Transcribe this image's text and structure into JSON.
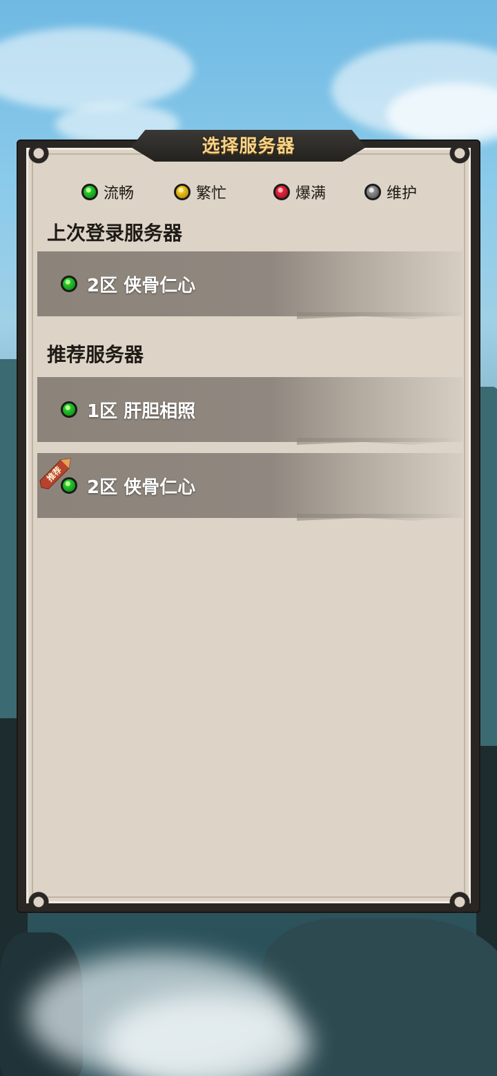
{
  "header": {
    "title": "选择服务器"
  },
  "legend": [
    {
      "label": "流畅",
      "color": "#26c92b",
      "icon": "status-green-dot"
    },
    {
      "label": "繁忙",
      "color": "#f0c21f",
      "icon": "status-yellow-dot"
    },
    {
      "label": "爆满",
      "color": "#e5263d",
      "icon": "status-red-dot"
    },
    {
      "label": "维护",
      "color": "#8f8f8f",
      "icon": "status-gray-dot"
    }
  ],
  "last_login": {
    "title": "上次登录服务器",
    "servers": [
      {
        "name": "2区 侠骨仁心",
        "status": "流畅"
      }
    ]
  },
  "recommended": {
    "title": "推荐服务器",
    "servers": [
      {
        "name": "1区 肝胆相照",
        "status": "流畅"
      },
      {
        "name": "2区 侠骨仁心",
        "status": "流畅",
        "badge": "推荐"
      }
    ]
  },
  "colors": {
    "title_gold": "#f6d48a",
    "panel_bg": "#ddd4c7",
    "row_bg": "#8c847a"
  }
}
